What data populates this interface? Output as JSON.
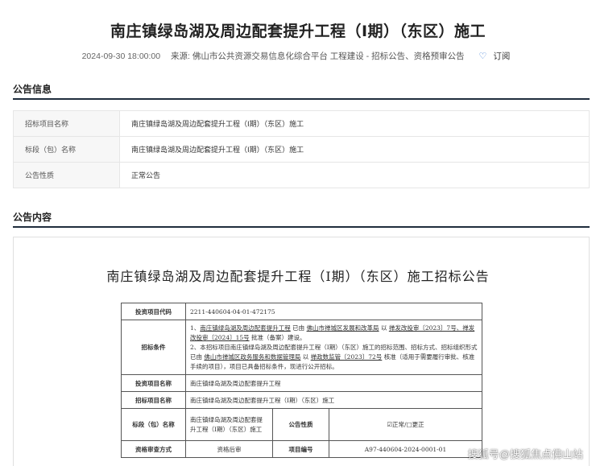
{
  "header": {
    "title": "南庄镇绿岛湖及周边配套提升工程（Ⅰ期）（东区）施工",
    "date": "2024-09-30 18:00:00",
    "source": "来源: 佛山市公共资源交易信息化综合平台 工程建设 - 招标公告、资格预审公告",
    "subscribe": "订阅"
  },
  "info_section": {
    "title": "公告信息",
    "rows": [
      {
        "label": "招标项目名称",
        "value": "南庄镇绿岛湖及周边配套提升工程（Ⅰ期）（东区）施工"
      },
      {
        "label": "标段（包）名称",
        "value": "南庄镇绿岛湖及周边配套提升工程（Ⅰ期）（东区）施工"
      },
      {
        "label": "公告性质",
        "value": "正常公告"
      }
    ]
  },
  "content_section": {
    "title": "公告内容",
    "doc_title": "南庄镇绿岛湖及周边配套提升工程（Ⅰ期）（东区）施工招标公告",
    "table": {
      "investment_code_label": "投资项目代码",
      "investment_code": "2211-440604-04-01-472175",
      "conditions_label": "招标条件",
      "cond1_a": "1、",
      "cond1_b": "南庄镇绿岛湖及周边配套提升工程",
      "cond1_c": " 已由 ",
      "cond1_d": "佛山市禅城区发展和改革局",
      "cond1_e": " 以 ",
      "cond1_f": "禅发改投审〔2023〕7号、禅发改投审〔2024〕15号",
      "cond1_g": " 批准（备案）建设。",
      "cond2_a": "2、本招标项目南庄镇绿岛湖及周边配套提升工程（Ⅰ期）（东区）施工的招标范围、招标方式、招标组织形式已由 ",
      "cond2_b": "佛山市禅城区政务服务和数据管理局",
      "cond2_c": " 以 ",
      "cond2_d": "禅政数监管〔2023〕72号",
      "cond2_e": " 核准（适用于需要履行审批、核准手续的项目），项目已具备招标条件，现进行公开招标。",
      "investment_name_label": "投资项目名称",
      "investment_name": "南庄镇绿岛湖及周边配套提升工程",
      "bid_project_label": "招标项目名称",
      "bid_project": "南庄镇绿岛湖及周边配套提升工程（Ⅰ期）（东区）施工",
      "section_label": "标段（包）名称",
      "section_name": "南庄镇绿岛湖及周边配套提升工程（Ⅰ期）（东区）施工",
      "nature_label": "公告性质",
      "nature_value": "☑正常/□更正",
      "review_label": "资格审查方式",
      "review_value": "资格后审",
      "project_no_label": "项目编号",
      "project_no": "A97-440604-2024-0001-01"
    }
  },
  "watermark": "搜狐号@搜狐焦点佛山站"
}
